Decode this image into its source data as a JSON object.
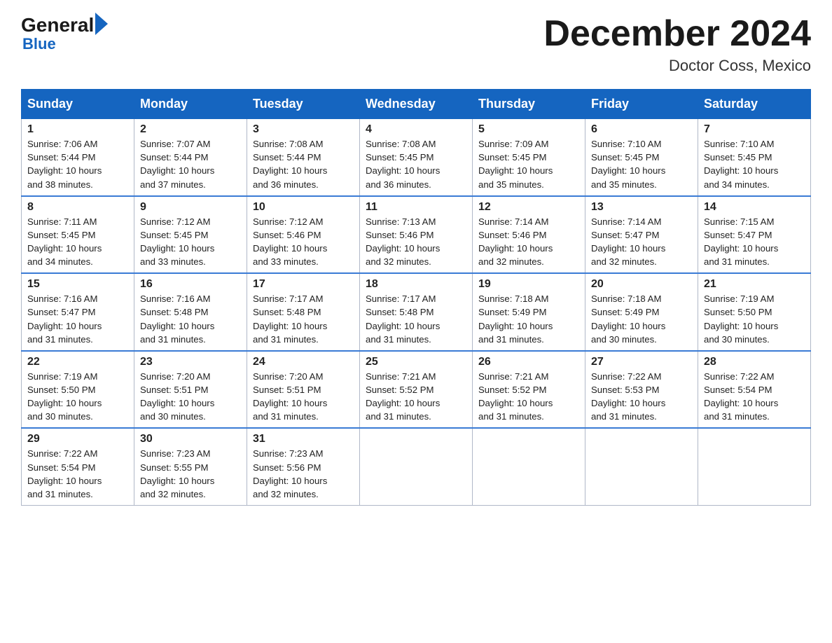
{
  "logo": {
    "general": "General",
    "blue": "Blue"
  },
  "title": "December 2024",
  "location": "Doctor Coss, Mexico",
  "days_header": [
    "Sunday",
    "Monday",
    "Tuesday",
    "Wednesday",
    "Thursday",
    "Friday",
    "Saturday"
  ],
  "weeks": [
    [
      {
        "num": "1",
        "sunrise": "7:06 AM",
        "sunset": "5:44 PM",
        "daylight": "10 hours and 38 minutes."
      },
      {
        "num": "2",
        "sunrise": "7:07 AM",
        "sunset": "5:44 PM",
        "daylight": "10 hours and 37 minutes."
      },
      {
        "num": "3",
        "sunrise": "7:08 AM",
        "sunset": "5:44 PM",
        "daylight": "10 hours and 36 minutes."
      },
      {
        "num": "4",
        "sunrise": "7:08 AM",
        "sunset": "5:45 PM",
        "daylight": "10 hours and 36 minutes."
      },
      {
        "num": "5",
        "sunrise": "7:09 AM",
        "sunset": "5:45 PM",
        "daylight": "10 hours and 35 minutes."
      },
      {
        "num": "6",
        "sunrise": "7:10 AM",
        "sunset": "5:45 PM",
        "daylight": "10 hours and 35 minutes."
      },
      {
        "num": "7",
        "sunrise": "7:10 AM",
        "sunset": "5:45 PM",
        "daylight": "10 hours and 34 minutes."
      }
    ],
    [
      {
        "num": "8",
        "sunrise": "7:11 AM",
        "sunset": "5:45 PM",
        "daylight": "10 hours and 34 minutes."
      },
      {
        "num": "9",
        "sunrise": "7:12 AM",
        "sunset": "5:45 PM",
        "daylight": "10 hours and 33 minutes."
      },
      {
        "num": "10",
        "sunrise": "7:12 AM",
        "sunset": "5:46 PM",
        "daylight": "10 hours and 33 minutes."
      },
      {
        "num": "11",
        "sunrise": "7:13 AM",
        "sunset": "5:46 PM",
        "daylight": "10 hours and 32 minutes."
      },
      {
        "num": "12",
        "sunrise": "7:14 AM",
        "sunset": "5:46 PM",
        "daylight": "10 hours and 32 minutes."
      },
      {
        "num": "13",
        "sunrise": "7:14 AM",
        "sunset": "5:47 PM",
        "daylight": "10 hours and 32 minutes."
      },
      {
        "num": "14",
        "sunrise": "7:15 AM",
        "sunset": "5:47 PM",
        "daylight": "10 hours and 31 minutes."
      }
    ],
    [
      {
        "num": "15",
        "sunrise": "7:16 AM",
        "sunset": "5:47 PM",
        "daylight": "10 hours and 31 minutes."
      },
      {
        "num": "16",
        "sunrise": "7:16 AM",
        "sunset": "5:48 PM",
        "daylight": "10 hours and 31 minutes."
      },
      {
        "num": "17",
        "sunrise": "7:17 AM",
        "sunset": "5:48 PM",
        "daylight": "10 hours and 31 minutes."
      },
      {
        "num": "18",
        "sunrise": "7:17 AM",
        "sunset": "5:48 PM",
        "daylight": "10 hours and 31 minutes."
      },
      {
        "num": "19",
        "sunrise": "7:18 AM",
        "sunset": "5:49 PM",
        "daylight": "10 hours and 31 minutes."
      },
      {
        "num": "20",
        "sunrise": "7:18 AM",
        "sunset": "5:49 PM",
        "daylight": "10 hours and 30 minutes."
      },
      {
        "num": "21",
        "sunrise": "7:19 AM",
        "sunset": "5:50 PM",
        "daylight": "10 hours and 30 minutes."
      }
    ],
    [
      {
        "num": "22",
        "sunrise": "7:19 AM",
        "sunset": "5:50 PM",
        "daylight": "10 hours and 30 minutes."
      },
      {
        "num": "23",
        "sunrise": "7:20 AM",
        "sunset": "5:51 PM",
        "daylight": "10 hours and 30 minutes."
      },
      {
        "num": "24",
        "sunrise": "7:20 AM",
        "sunset": "5:51 PM",
        "daylight": "10 hours and 31 minutes."
      },
      {
        "num": "25",
        "sunrise": "7:21 AM",
        "sunset": "5:52 PM",
        "daylight": "10 hours and 31 minutes."
      },
      {
        "num": "26",
        "sunrise": "7:21 AM",
        "sunset": "5:52 PM",
        "daylight": "10 hours and 31 minutes."
      },
      {
        "num": "27",
        "sunrise": "7:22 AM",
        "sunset": "5:53 PM",
        "daylight": "10 hours and 31 minutes."
      },
      {
        "num": "28",
        "sunrise": "7:22 AM",
        "sunset": "5:54 PM",
        "daylight": "10 hours and 31 minutes."
      }
    ],
    [
      {
        "num": "29",
        "sunrise": "7:22 AM",
        "sunset": "5:54 PM",
        "daylight": "10 hours and 31 minutes."
      },
      {
        "num": "30",
        "sunrise": "7:23 AM",
        "sunset": "5:55 PM",
        "daylight": "10 hours and 32 minutes."
      },
      {
        "num": "31",
        "sunrise": "7:23 AM",
        "sunset": "5:56 PM",
        "daylight": "10 hours and 32 minutes."
      },
      null,
      null,
      null,
      null
    ]
  ],
  "labels": {
    "sunrise": "Sunrise:",
    "sunset": "Sunset:",
    "daylight": "Daylight:"
  }
}
